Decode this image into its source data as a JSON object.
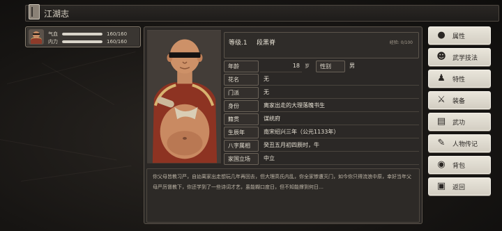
{
  "window": {
    "title": "江湖志"
  },
  "member": {
    "hp": {
      "label": "气血",
      "value": "160/160",
      "fraction": 1.0
    },
    "mp": {
      "label": "内力",
      "value": "160/160",
      "fraction": 1.0
    }
  },
  "character": {
    "level": "等级.1",
    "name": "段黑脊",
    "exp": "经验: 0/100",
    "fields": {
      "age": {
        "label": "年龄",
        "value": "18",
        "unit": "岁"
      },
      "gender": {
        "label": "性别",
        "value": "男"
      },
      "nickname": {
        "label": "花名",
        "value": "无"
      },
      "sect": {
        "label": "门派",
        "value": "无"
      },
      "identity": {
        "label": "身份",
        "value": "离家出走的大理落魄书生"
      },
      "hometown": {
        "label": "籍贯",
        "value": "谋统府"
      },
      "birth_year": {
        "label": "生辰年",
        "value": "南宋绍兴三年（公元1133年）"
      },
      "bazi": {
        "label": "八字属相",
        "value": "癸丑五月初四辰时，牛"
      },
      "stance": {
        "label": "家国立场",
        "value": "中立"
      }
    },
    "bio": "你父母皆教习严，自幼离家出走想玩几年再回去，但大理高氏内乱，你全家惨遭灭门，如今你只得流浪中原，幸好当年父母严厉督教下，你还学到了一些诗词才艺，虽能糊口度日，但不知能撑到何日…"
  },
  "menu": [
    {
      "label": "属性",
      "icon": "attribute-icon"
    },
    {
      "label": "武学技法",
      "icon": "martial-skill-icon"
    },
    {
      "label": "特性",
      "icon": "trait-icon"
    },
    {
      "label": "装备",
      "icon": "equipment-icon"
    },
    {
      "label": "武功",
      "icon": "kungfu-icon"
    },
    {
      "label": "人物传记",
      "icon": "biography-icon"
    },
    {
      "label": "背包",
      "icon": "bag-icon"
    },
    {
      "label": "返回",
      "icon": "return-icon"
    }
  ]
}
